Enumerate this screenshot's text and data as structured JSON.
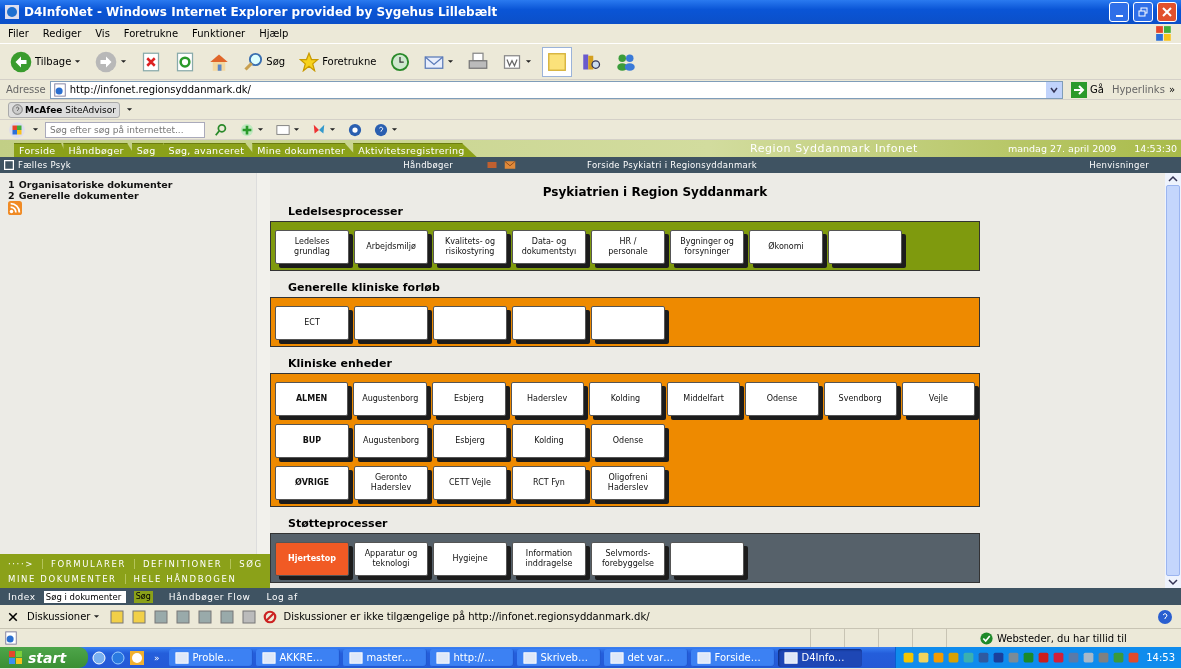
{
  "window": {
    "title": "D4InfoNet - Windows Internet Explorer provided by Sygehus Lillebælt"
  },
  "menu": [
    "Filer",
    "Rediger",
    "Vis",
    "Foretrukne",
    "Funktioner",
    "Hjælp"
  ],
  "toolbar": {
    "back": "Tilbage",
    "search": "Søg",
    "favorites": "Foretrukne"
  },
  "address": {
    "label": "Adresse",
    "url": "http://infonet.regionsyddanmark.dk/",
    "go": "Gå",
    "links": "Hyperlinks",
    "more": "»"
  },
  "mcafee": {
    "label": "**McAfee** SiteAdvisor"
  },
  "web_search": {
    "placeholder": "Søg efter søg på internettet..."
  },
  "site": {
    "tabs": [
      "Forside",
      "Håndbøger",
      "Søg",
      "Søg, avanceret",
      "Mine dokumenter",
      "Aktivitetsregistrering"
    ],
    "banner": "Region Syddanmark Infonet",
    "date": "mandag 27. april 2009",
    "time": "14:53:30"
  },
  "subbar": {
    "unit": "Fælles Psyk",
    "menu": "Håndbøger",
    "breadcrumb": "Forside Psykiatri i Regionsyddanmark",
    "links": "Henvisninger"
  },
  "sidebar": {
    "items": [
      {
        "number": "1",
        "label": "Organisatoriske dokumenter"
      },
      {
        "number": "2",
        "label": "Generelle dokumenter"
      }
    ],
    "bottom_rows": [
      [
        "····>",
        "FORMULARER",
        "DEFINITIONER",
        "SØG"
      ],
      [
        "MINE DOKUMENTER",
        "HELE HÅNDBOGEN"
      ]
    ]
  },
  "page_title": "Psykiatrien i Region Syddanmark",
  "sections": [
    {
      "heading": "Ledelsesprocesser",
      "color": "#7f9a0e",
      "rows": [
        [
          {
            "kind": "tile",
            "label": "Ledelses grundlag"
          },
          {
            "kind": "tile",
            "label": "Arbejdsmiljø"
          },
          {
            "kind": "tile",
            "label": "Kvalitets- og risikostyring"
          },
          {
            "kind": "tile",
            "label": "Data- og dokumentstyı"
          },
          {
            "kind": "tile",
            "label": "HR / personale"
          },
          {
            "kind": "tile",
            "label": "Bygninger og forsyninger"
          },
          {
            "kind": "tile",
            "label": "Økonomi"
          },
          {
            "kind": "blank"
          }
        ]
      ]
    },
    {
      "heading": "Generelle kliniske forløb",
      "color": "#ee8a00",
      "rows": [
        [
          {
            "kind": "tile",
            "label": "ECT"
          },
          {
            "kind": "blank"
          },
          {
            "kind": "blank"
          },
          {
            "kind": "blank"
          },
          {
            "kind": "blank"
          }
        ]
      ]
    },
    {
      "heading": "Kliniske enheder",
      "color": "#ee8a00",
      "rows": [
        [
          {
            "kind": "header",
            "label": "ALMEN"
          },
          {
            "kind": "tile",
            "label": "Augustenborg"
          },
          {
            "kind": "tile",
            "label": "Esbjerg"
          },
          {
            "kind": "tile",
            "label": "Haderslev"
          },
          {
            "kind": "tile",
            "label": "Kolding"
          },
          {
            "kind": "tile",
            "label": "Middelfart"
          },
          {
            "kind": "tile",
            "label": "Odense"
          },
          {
            "kind": "tile",
            "label": "Svendborg"
          },
          {
            "kind": "tile",
            "label": "Vejle"
          }
        ],
        [
          {
            "kind": "header",
            "label": "BUP"
          },
          {
            "kind": "tile",
            "label": "Augustenborg"
          },
          {
            "kind": "tile",
            "label": "Esbjerg"
          },
          {
            "kind": "tile",
            "label": "Kolding"
          },
          {
            "kind": "tile",
            "label": "Odense"
          }
        ],
        [
          {
            "kind": "header",
            "label": "ØVRIGE"
          },
          {
            "kind": "tile",
            "label": "Geronto Haderslev"
          },
          {
            "kind": "tile",
            "label": "CETT Vejle"
          },
          {
            "kind": "tile",
            "label": "RCT Fyn"
          },
          {
            "kind": "tile",
            "label": "Oligofreni Haderslev"
          }
        ]
      ]
    },
    {
      "heading": "Støtteprocesser",
      "color": "#56616a",
      "rows": [
        [
          {
            "kind": "alert",
            "label": "Hjertestop"
          },
          {
            "kind": "tile",
            "label": "Apparatur og teknologi"
          },
          {
            "kind": "tile",
            "label": "Hygiejne"
          },
          {
            "kind": "tile",
            "label": "Information inddragelse"
          },
          {
            "kind": "tile",
            "label": "Selvmords-forebyggelse"
          },
          {
            "kind": "blank"
          }
        ]
      ]
    }
  ],
  "footer": {
    "index": "Index",
    "search_value": "Søg i dokumenter",
    "search_button": "Søg",
    "links": [
      "Håndbøger Flow",
      "Log af"
    ]
  },
  "discussion": {
    "label": "Diskussioner",
    "message": "Diskussioner er ikke tilgængelige på http://infonet.regionsyddanmark.dk/"
  },
  "status": {
    "zone": "Websteder, du har tillid til"
  },
  "taskbar": {
    "start": "start",
    "more": "»",
    "tasks": [
      {
        "label": "Proble…",
        "selected": false
      },
      {
        "label": "AKKRE…",
        "selected": false
      },
      {
        "label": "master…",
        "selected": false
      },
      {
        "label": "http://…",
        "selected": false
      },
      {
        "label": "Skriveb…",
        "selected": false
      },
      {
        "label": "det var…",
        "selected": false
      },
      {
        "label": "Forside…",
        "selected": false
      },
      {
        "label": "D4Info…",
        "selected": true
      }
    ],
    "clock": "14:53"
  }
}
